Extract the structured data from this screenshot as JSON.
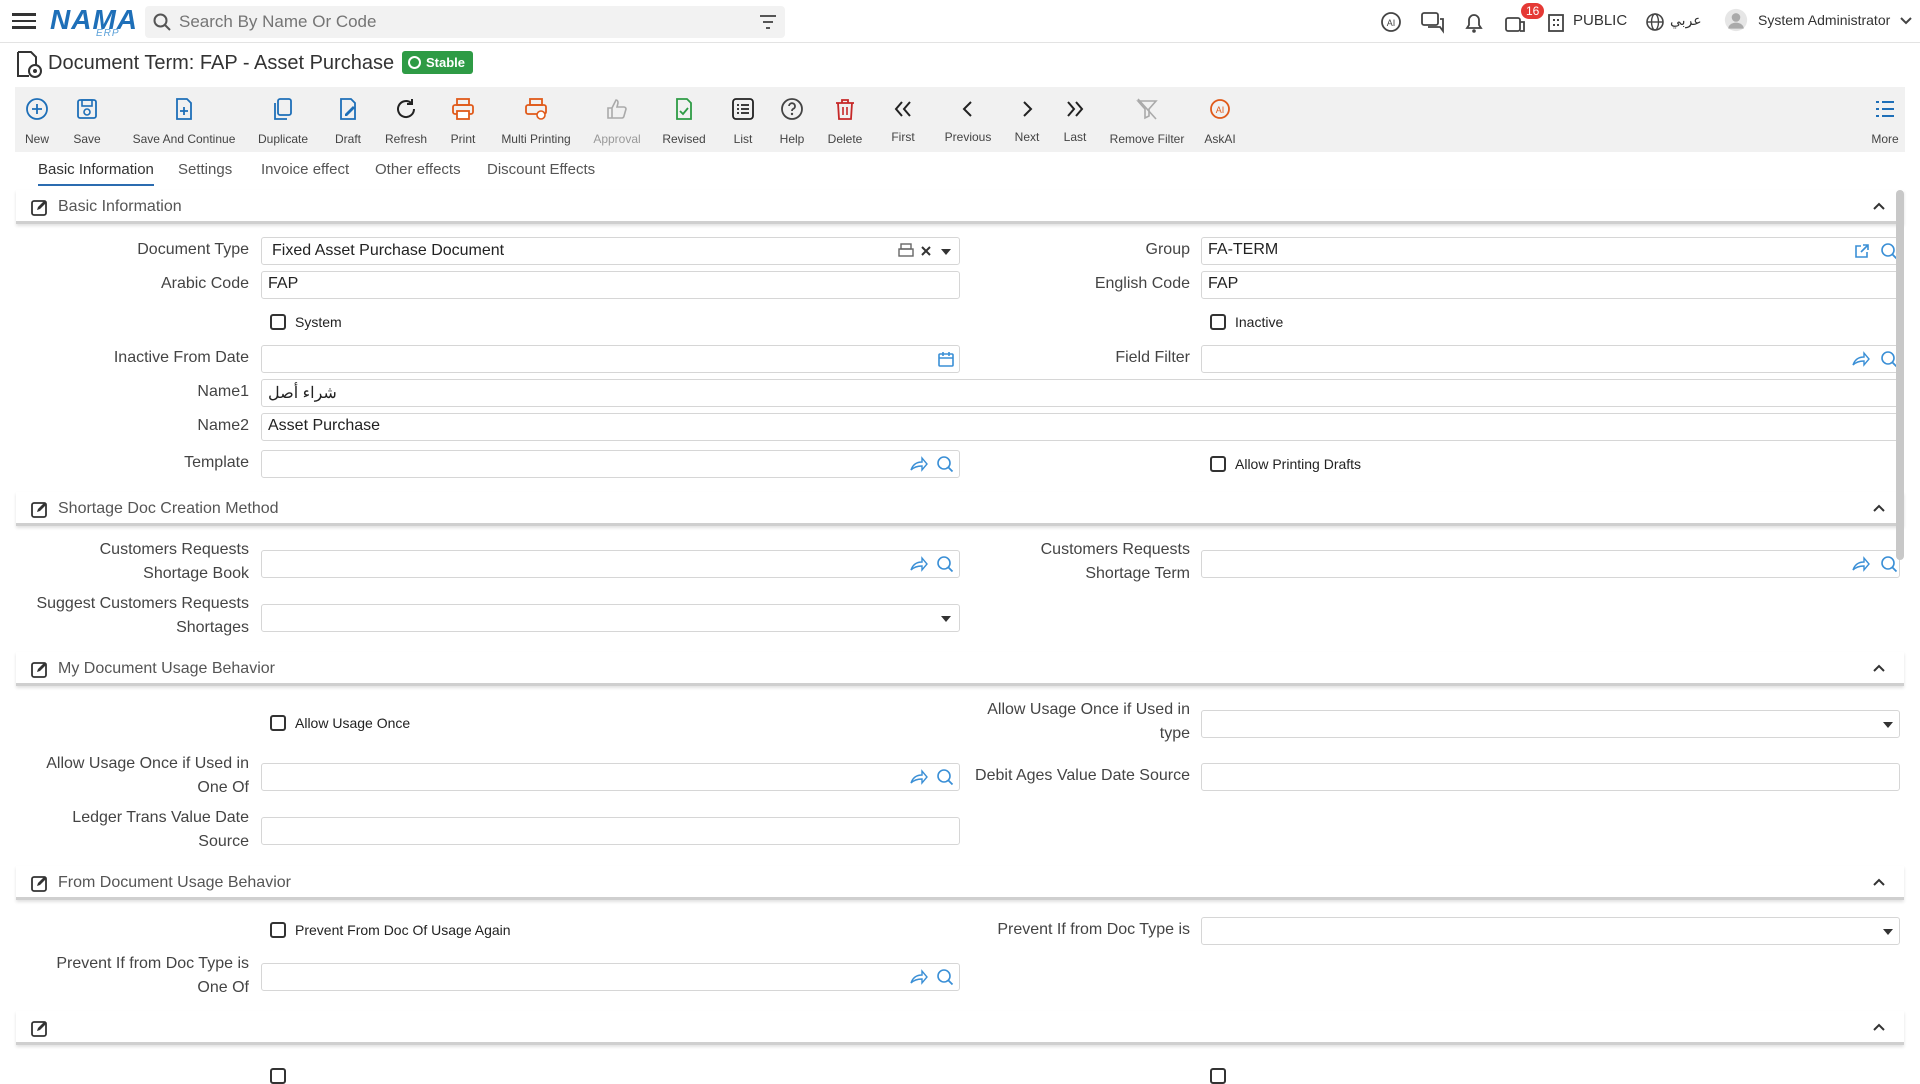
{
  "topbar": {
    "search_placeholder": "Search By Name Or Code",
    "notification_count": "16",
    "branch": "PUBLIC",
    "language": "عربي",
    "user": "System Administrator"
  },
  "header": {
    "title": "Document Term: FAP - Asset Purchase",
    "status": "Stable"
  },
  "toolbar": {
    "new": "New",
    "save": "Save",
    "save_continue": "Save And Continue",
    "duplicate": "Duplicate",
    "draft": "Draft",
    "refresh": "Refresh",
    "print": "Print",
    "multi_printing": "Multi Printing",
    "approval": "Approval",
    "revised": "Revised",
    "list": "List",
    "help": "Help",
    "delete": "Delete",
    "first": "First",
    "previous": "Previous",
    "next": "Next",
    "last": "Last",
    "remove_filter": "Remove Filter",
    "askai": "AskAI",
    "more": "More"
  },
  "tabs": [
    "Basic Information",
    "Settings",
    "Invoice effect",
    "Other effects",
    "Discount Effects"
  ],
  "sections": {
    "basic": "Basic Information",
    "shortage": "Shortage Doc Creation Method",
    "my_usage": "My Document Usage Behavior",
    "from_usage": "From Document Usage Behavior"
  },
  "basic": {
    "doc_type_label": "Document Type",
    "doc_type_value": "Fixed Asset Purchase Document",
    "group_label": "Group",
    "group_value": "FA-TERM",
    "arabic_code_label": "Arabic Code",
    "arabic_code_value": "FAP",
    "english_code_label": "English Code",
    "english_code_value": "FAP",
    "system_label": "System",
    "inactive_label": "Inactive",
    "inactive_from_label": "Inactive From Date",
    "field_filter_label": "Field Filter",
    "name1_label": "Name1",
    "name1_value": "شراء أصل",
    "name2_label": "Name2",
    "name2_value": "Asset Purchase",
    "template_label": "Template",
    "allow_printing_drafts_label": "Allow Printing Drafts"
  },
  "shortage": {
    "cust_req_book_label_1": "Customers Requests",
    "cust_req_book_label_2": "Shortage Book",
    "cust_req_term_label_1": "Customers Requests",
    "cust_req_term_label_2": "Shortage Term",
    "suggest_label_1": "Suggest Customers Requests",
    "suggest_label_2": "Shortages"
  },
  "my_usage": {
    "allow_once_label": "Allow Usage Once",
    "allow_once_type_label_1": "Allow Usage Once if Used in",
    "allow_once_type_label_2": "type",
    "allow_once_oneof_label_1": "Allow Usage Once if Used in",
    "allow_once_oneof_label_2": "One Of",
    "debit_ages_label": "Debit Ages Value Date Source",
    "ledger_label_1": "Ledger Trans Value Date",
    "ledger_label_2": "Source"
  },
  "from_usage": {
    "prevent_again_label": "Prevent From Doc Of Usage Again",
    "prevent_type_label": "Prevent If from Doc Type is",
    "prevent_oneof_label_1": "Prevent If from Doc Type is",
    "prevent_oneof_label_2": "One Of"
  }
}
